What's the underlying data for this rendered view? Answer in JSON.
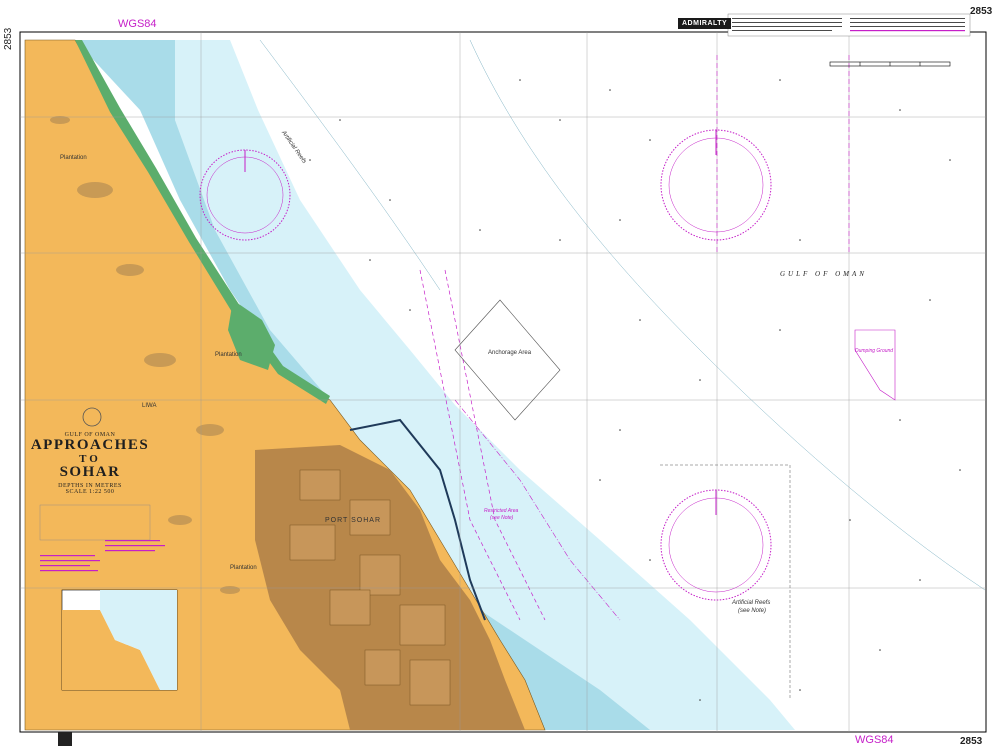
{
  "chart": {
    "number": "2853",
    "datum_label": "WGS84",
    "publisher_badge": "ADMIRALTY",
    "region": "GULF OF OMAN",
    "title_line1": "APPROACHES",
    "title_line2": "TO",
    "title_line3": "SOHAR",
    "depths_note": "DEPTHS IN METRES",
    "scale": "SCALE 1:22 500"
  },
  "labels": {
    "gulf": "GULF OF OMAN",
    "port": "PORT SOHAR",
    "restricted_area": "Restricted Area",
    "restricted_note": "(see Note)",
    "artificial_reefs": "Artificial Reefs",
    "artificial_note": "(see Note)",
    "artificial_reefs_nw": "Artificial Reefs",
    "dumping_ground": "Dumping Ground",
    "anchorage": "Anchorage Area",
    "plantation_1": "Plantation",
    "plantation_2": "Plantation",
    "plantation_3": "Plantation",
    "liwa": "LIWA"
  },
  "colors": {
    "land": "#f3b85a",
    "built_up": "#b8874a",
    "deep_water": "#ffffff",
    "shallow_water": "#d7f2f9",
    "drying_water": "#a9dce9",
    "mangrove": "#5cad6c",
    "magenta": "#c51fc8"
  }
}
